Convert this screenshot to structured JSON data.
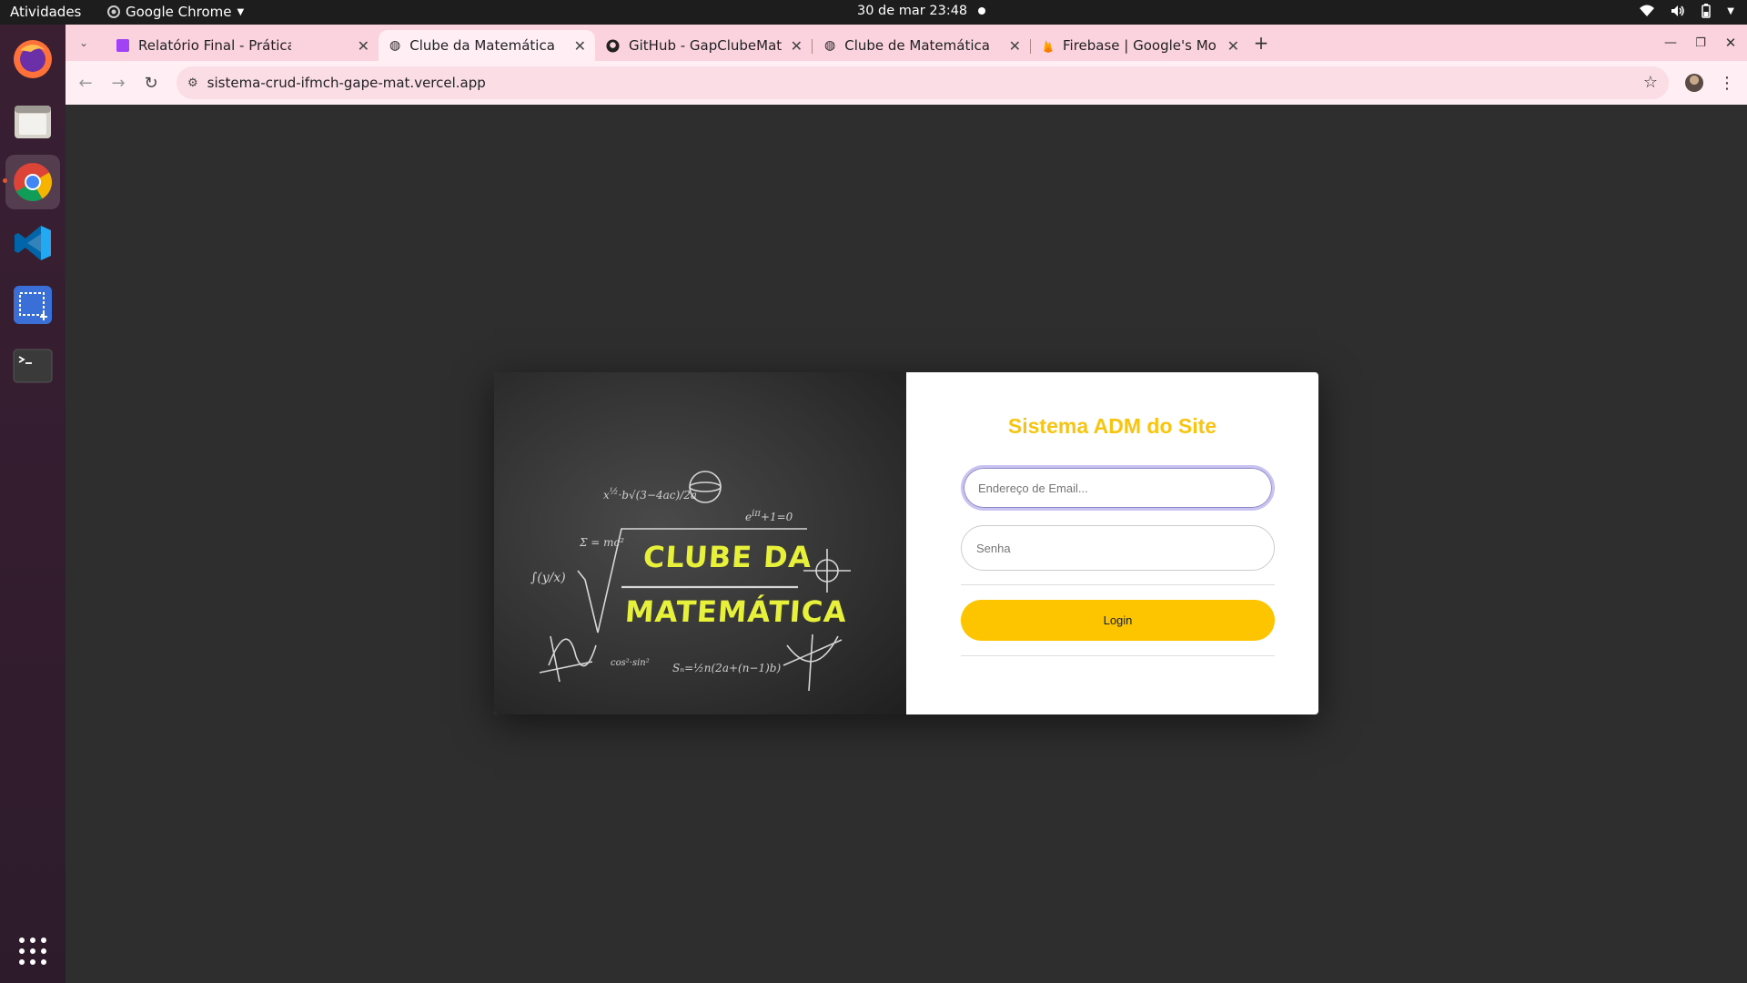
{
  "topbar": {
    "activities": "Atividades",
    "app_name": "Google Chrome",
    "clock": "30 de mar  23:48"
  },
  "browser": {
    "tabs": [
      {
        "title": "Relatório Final - Práticas",
        "icon": "document-icon",
        "active": false
      },
      {
        "title": "Clube da Matemática",
        "icon": "globe-icon",
        "active": true
      },
      {
        "title": "GitHub - GapClubeMater",
        "icon": "github-icon",
        "active": false
      },
      {
        "title": "Clube de Matemática",
        "icon": "globe-icon",
        "active": false
      },
      {
        "title": "Firebase | Google's Mobi",
        "icon": "firebase-icon",
        "active": false
      }
    ],
    "url": "sistema-crud-ifmch-gape-mat.vercel.app"
  },
  "login": {
    "title": "Sistema ADM do Site",
    "email_placeholder": "Endereço de Email...",
    "password_placeholder": "Senha",
    "button_label": "Login"
  },
  "banner": {
    "line1": "CLUBE DA",
    "line2": "MATEMÁTICA"
  },
  "colors": {
    "accent_yellow": "#fdc500",
    "title_yellow": "#f7c510",
    "tabstrip_pink": "#fbd3de",
    "toolbar_pink": "#ffeef3",
    "chalk_yellow": "#e7f13a",
    "page_bg": "#2e2e2e"
  }
}
